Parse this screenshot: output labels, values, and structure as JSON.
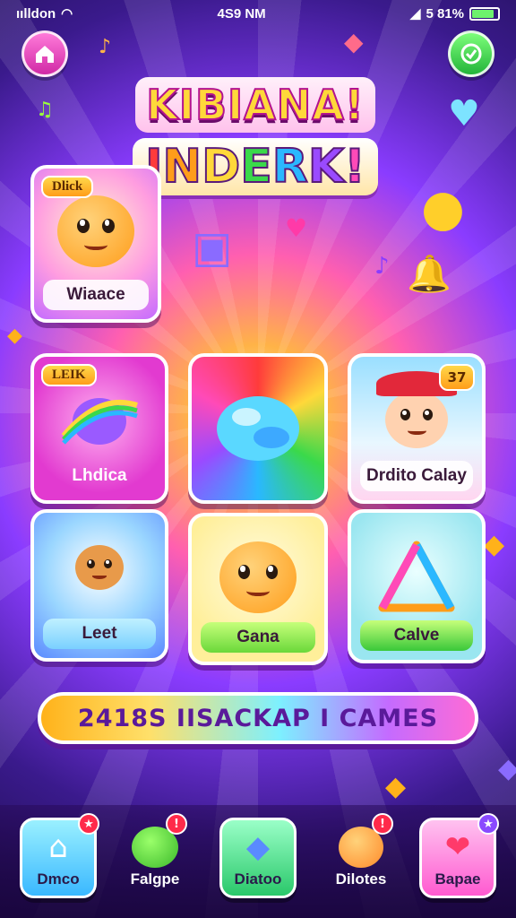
{
  "status_bar": {
    "carrier": "ıılldon",
    "time": "4S9 NM",
    "signal": "⁴",
    "battery_text": "5 81%"
  },
  "header": {
    "title_line1": "KIBIANA!",
    "title_line2_letters": [
      "I",
      "N",
      "D",
      "E",
      "R",
      "K",
      "!"
    ],
    "title_line2_colors": [
      "#ff3b3b",
      "#ff9d1a",
      "#ffd83a",
      "#3ad94a",
      "#2ab8ff",
      "#9a4aff",
      "#ff4ab8"
    ],
    "left_button_icon": "home-icon",
    "right_button_icon": "check-icon"
  },
  "cards": {
    "featured": {
      "badge": "Dlick",
      "label": "Wiaace"
    },
    "row1": [
      {
        "badge": "LEIK",
        "label": "Lhdica"
      },
      {
        "label": ""
      },
      {
        "badge": "37",
        "label": "Drdito Calay"
      }
    ],
    "row2": [
      {
        "label": "Leet"
      },
      {
        "label": "Gana"
      },
      {
        "label": "Calve"
      }
    ]
  },
  "banner": {
    "text": "2418S IISACKAP I  CAMES"
  },
  "bottom_nav": [
    {
      "label": "Dmco",
      "icon": "house-icon",
      "color": "#5ac8ff"
    },
    {
      "label": "Falgpe",
      "icon": "green-creature-icon",
      "color": "transparent"
    },
    {
      "label": "Diatoo",
      "icon": "gem-icon",
      "color": "#3ad98a"
    },
    {
      "label": "Dilotes",
      "icon": "pet-icon",
      "color": "transparent"
    },
    {
      "label": "Bapae",
      "icon": "cards-icon",
      "color": "#ff6bd5"
    }
  ]
}
